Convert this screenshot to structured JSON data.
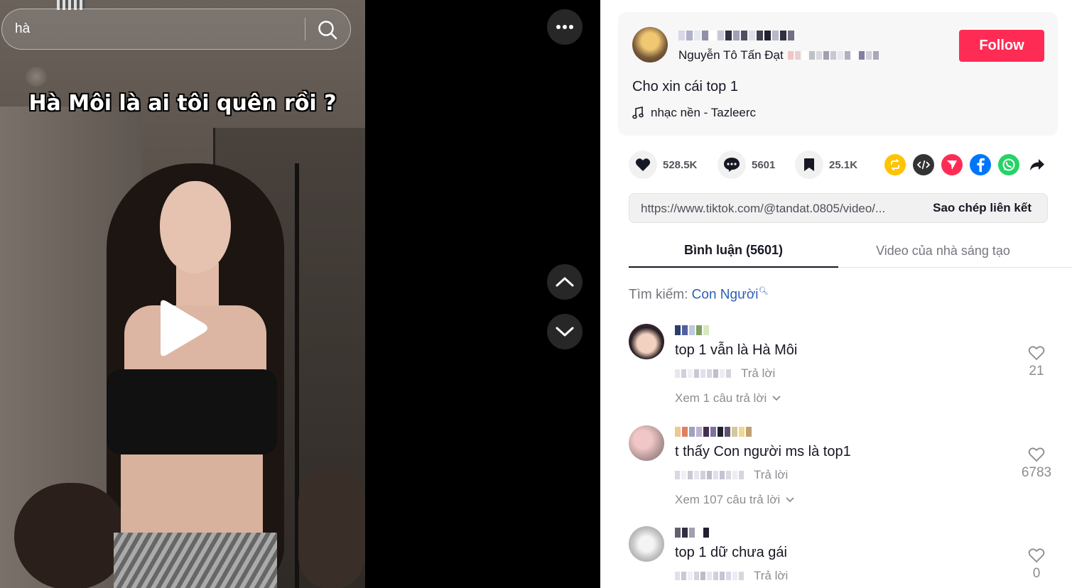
{
  "search": {
    "value": "hà",
    "placeholder": ""
  },
  "video": {
    "caption": "Hà Môi là ai tôi quên rồi ?"
  },
  "author": {
    "nickname": "Nguyễn Tô Tấn Đạt",
    "follow_label": "Follow",
    "description": "Cho xin cái top 1",
    "music": "nhạc nền - Tazleerc"
  },
  "stats": {
    "likes": "528.5K",
    "comments": "5601",
    "saves": "25.1K"
  },
  "share": {
    "url": "https://www.tiktok.com/@tandat.0805/video/...",
    "copy_label": "Sao chép liên kết",
    "icons": [
      "repost-icon",
      "embed-icon",
      "send-icon",
      "facebook-icon",
      "whatsapp-icon",
      "share-arrow-icon"
    ],
    "colors": {
      "repost": "#ffc300",
      "embed": "#333333",
      "send": "#fe2c55",
      "facebook": "#0075fa",
      "whatsapp": "#25d366"
    }
  },
  "tabs": {
    "comments": "Bình luận (5601)",
    "creator_videos": "Video của nhà sáng tạo"
  },
  "search_suggest": {
    "label": "Tìm kiếm:",
    "keyword": "Con Người"
  },
  "comments": [
    {
      "text": "top 1 vẫn là Hà Môi",
      "reply_label": "Trả lời",
      "likes": "21",
      "view_replies": "Xem 1 câu trả lời"
    },
    {
      "text": "t thấy Con người ms là top1",
      "reply_label": "Trả lời",
      "likes": "6783",
      "view_replies": "Xem 107 câu trả lời"
    },
    {
      "text": "top 1 dữ chưa gái",
      "reply_label": "Trả lời",
      "likes": "0",
      "view_replies": ""
    }
  ],
  "colors": {
    "accent": "#fe2c55",
    "link": "#2b5db9"
  }
}
